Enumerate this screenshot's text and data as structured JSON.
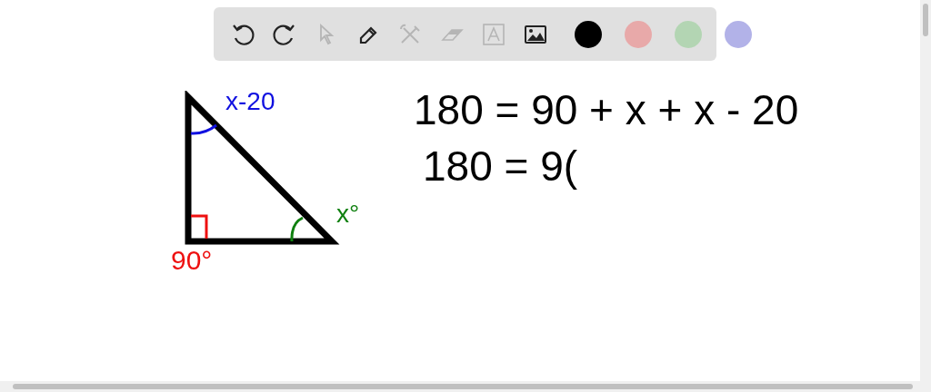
{
  "toolbar": {
    "tools": [
      {
        "kind": "undo",
        "disabled": false
      },
      {
        "kind": "redo",
        "disabled": false
      },
      {
        "kind": "pointer",
        "disabled": true
      },
      {
        "kind": "pen",
        "disabled": false
      },
      {
        "kind": "tools",
        "disabled": true
      },
      {
        "kind": "eraser",
        "disabled": true
      },
      {
        "kind": "text",
        "disabled": true
      },
      {
        "kind": "image",
        "disabled": false
      }
    ],
    "colors": [
      {
        "color": "#000000"
      },
      {
        "color": "#e8a9a9"
      },
      {
        "color": "#b3d5b3"
      },
      {
        "color": "#b2b2e8"
      }
    ]
  },
  "canvas": {
    "labels": [
      {
        "text": "x-20",
        "color": "#1010e0"
      },
      {
        "text": "x°",
        "color": "#108010"
      },
      {
        "text": "90°",
        "color": "#ee1010"
      }
    ],
    "equations": [
      "180 = 90 + x + x - 20",
      "180 = 9("
    ]
  }
}
